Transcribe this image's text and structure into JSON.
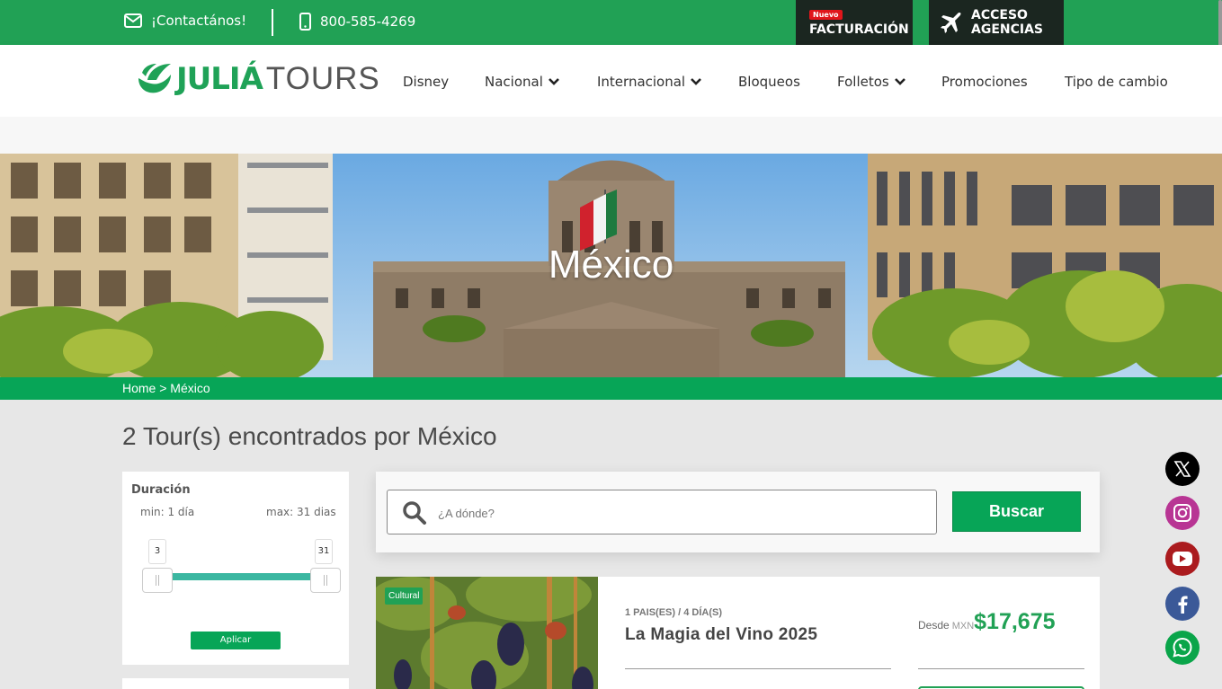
{
  "topbar": {
    "contact_label": "¡Contactános!",
    "phone": "800-585-4269",
    "facturacion_badge": "Nuevo",
    "facturacion_label": "FACTURACIÓN",
    "agencias_line1": "ACCESO",
    "agencias_line2": "AGENCIAS"
  },
  "logo": {
    "brand": "JULIÁ",
    "tours": "TOURS"
  },
  "nav": {
    "disney": "Disney",
    "nacional": "Nacional",
    "internacional": "Internacional",
    "bloqueos": "Bloqueos",
    "folletos": "Folletos",
    "promociones": "Promociones",
    "tipo_cambio": "Tipo de cambio"
  },
  "hero": {
    "title": "México"
  },
  "breadcrumb": "Home > México",
  "results_title": "2 Tour(s) encontrados por México",
  "filter": {
    "title": "Duración",
    "min_label": "min: 1 día",
    "max_label": "max: 31 dias",
    "low_value": "3",
    "high_value": "31",
    "apply_label": "Aplicar"
  },
  "search": {
    "placeholder": "¿A dónde?",
    "button_label": "Buscar"
  },
  "tours": [
    {
      "badge": "Cultural",
      "meta": "1 PAIS(ES) / 4 DÍA(S)",
      "name": "La Magia del Vino 2025",
      "price_prefix": "Desde",
      "currency": "MXN",
      "price": "$17,675"
    }
  ],
  "colors": {
    "brand_green": "#21a155",
    "dark": "#1b2620",
    "price_green": "#21a155"
  }
}
